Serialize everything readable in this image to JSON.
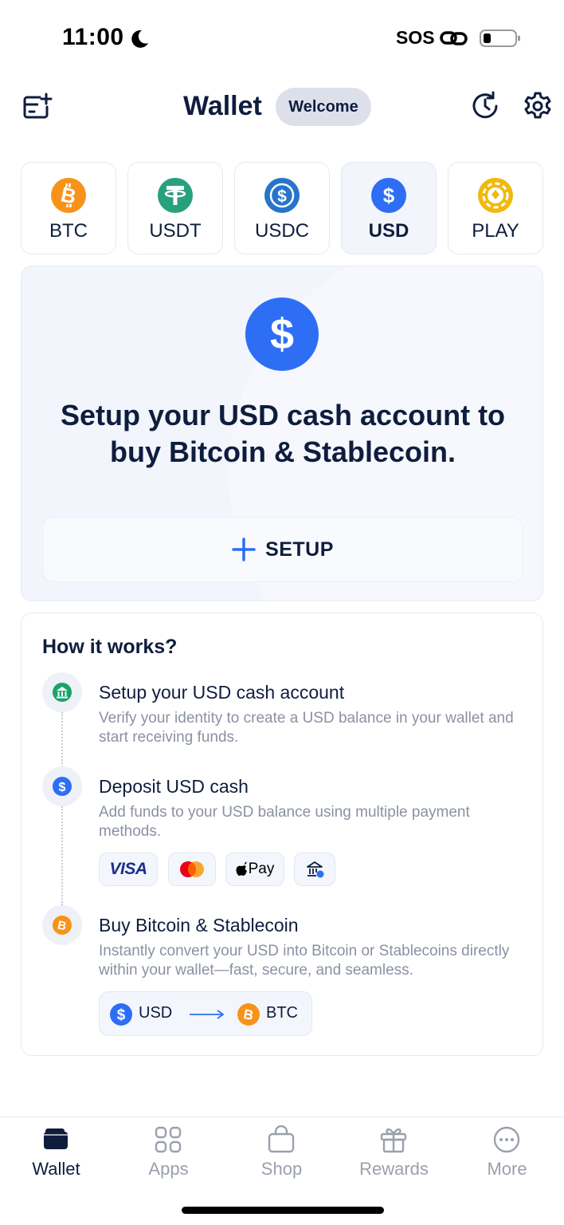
{
  "status_bar": {
    "time": "11:00",
    "sos": "SOS"
  },
  "header": {
    "title": "Wallet",
    "badge": "Welcome"
  },
  "tabs": [
    {
      "label": "BTC",
      "color": "#f7931a",
      "icon": "bitcoin-icon"
    },
    {
      "label": "USDT",
      "color": "#26a17b",
      "icon": "tether-icon"
    },
    {
      "label": "USDC",
      "color": "#2775ca",
      "icon": "usdc-icon"
    },
    {
      "label": "USD",
      "color": "#2d6ef5",
      "icon": "dollar-icon",
      "active": true
    },
    {
      "label": "PLAY",
      "color": "#f0b90b",
      "icon": "poker-chip-icon"
    }
  ],
  "promo": {
    "title": "Setup your USD cash account to buy Bitcoin & Stablecoin.",
    "button_label": "SETUP"
  },
  "how_it_works": {
    "title": "How it works?",
    "steps": [
      {
        "title": "Setup your USD cash account",
        "description": "Verify your identity to create a USD balance in your wallet and start receiving funds.",
        "icon": "bank-icon",
        "color": "#1aa36a"
      },
      {
        "title": "Deposit USD cash",
        "description": "Add funds to your USD balance using multiple payment methods.",
        "icon": "dollar-icon",
        "color": "#2d6ef5"
      },
      {
        "title": "Buy Bitcoin & Stablecoin",
        "description": "Instantly convert your USD into Bitcoin or Stablecoins directly within your wallet—fast, secure, and seamless.",
        "icon": "bitcoin-icon",
        "color": "#f7931a"
      }
    ],
    "payment_methods": [
      "VISA",
      "mastercard",
      "Pay",
      "bank"
    ],
    "conversion": {
      "from": "USD",
      "to": "BTC"
    }
  },
  "bottom_nav": [
    {
      "label": "Wallet",
      "icon": "wallet-icon",
      "active": true
    },
    {
      "label": "Apps",
      "icon": "apps-grid-icon"
    },
    {
      "label": "Shop",
      "icon": "shopping-bag-icon"
    },
    {
      "label": "Rewards",
      "icon": "gift-icon"
    },
    {
      "label": "More",
      "icon": "more-dots-icon"
    }
  ],
  "colors": {
    "text_primary": "#0f1d3d",
    "accent_blue": "#2d6ef5",
    "muted": "#8a91a3"
  }
}
